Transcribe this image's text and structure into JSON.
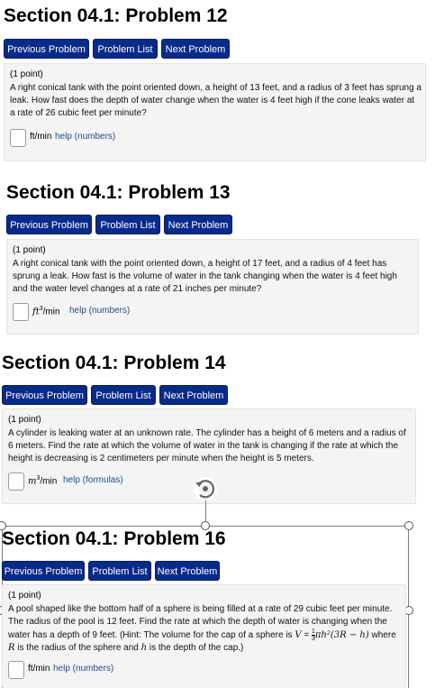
{
  "problems": [
    {
      "title": "Section 04.1: Problem 12",
      "nav": {
        "previous": "Previous Problem",
        "list": "Problem List",
        "next": "Next Problem"
      },
      "points": "(1 point)",
      "text": "A right conical tank with the point oriented down, a height of 13 feet, and a radius of 3 feet has sprung a leak. How fast does the depth of water change when the water is 4 feet high if the cone leaks water at a rate of 26 cubic feet per minute?",
      "unit": "ft/min",
      "help": "help (numbers)"
    },
    {
      "title": "Section 04.1: Problem 13",
      "nav": {
        "previous": "Previous Problem",
        "list": "Problem List",
        "next": "Next Problem"
      },
      "points": "(1 point)",
      "text": "A right conical tank with the point oriented down, a height of 17 feet, and a radius of 4 feet has sprung a leak. How fast is the volume of water in the tank changing when the water is 4 feet high and the water level changes at a rate of 21 inches per minute?",
      "unit_var": "ft",
      "unit_exp": "3",
      "unit_rest": "/min",
      "help": "help (numbers)"
    },
    {
      "title": "Section 04.1: Problem 14",
      "nav": {
        "previous": "Previous Problem",
        "list": "Problem List",
        "next": "Next Problem"
      },
      "points": "(1 point)",
      "text": "A cylinder is leaking water at an unknown rate. The cylinder has a height of 6 meters and a radius of 6 meters. Find the rate at which the volume of water in the tank is changing if the rate at which the height is decreasing is 2 centimeters per minute when the height is 5 meters.",
      "unit_var": "m",
      "unit_exp": "3",
      "unit_rest": "/min",
      "help": "help (formulas)"
    },
    {
      "title": "Section 04.1: Problem 16",
      "nav": {
        "previous": "Previous Problem",
        "list": "Problem List",
        "next": "Next Problem"
      },
      "points": "(1 point)",
      "text_a": "A pool shaped like the bottom half of a sphere is being filled at a rate of 29 cubic feet per minute. The radius of the pool is 12 feet. Find the rate at which the depth of water is changing when the water has a depth of 9 feet. (Hint: The volume for the cap of a sphere is ",
      "formula_lhs": "V",
      "formula_eq": " = ",
      "formula_num": "1",
      "formula_den": "3",
      "formula_rest": "πh²(3R − h)",
      "text_b": " where ",
      "var_R": "R",
      "text_c": " is the radius of the sphere and ",
      "var_h": "h",
      "text_d": " is the depth of the cap.)",
      "unit": "ft/min",
      "help": "help (numbers)"
    }
  ],
  "icons": {
    "rotate": "rotate-handle-icon",
    "handle": "selection-handle-icon"
  },
  "colors": {
    "button": "#082a8b",
    "link": "#1f4e8c",
    "panel": "#f4f4f4"
  }
}
